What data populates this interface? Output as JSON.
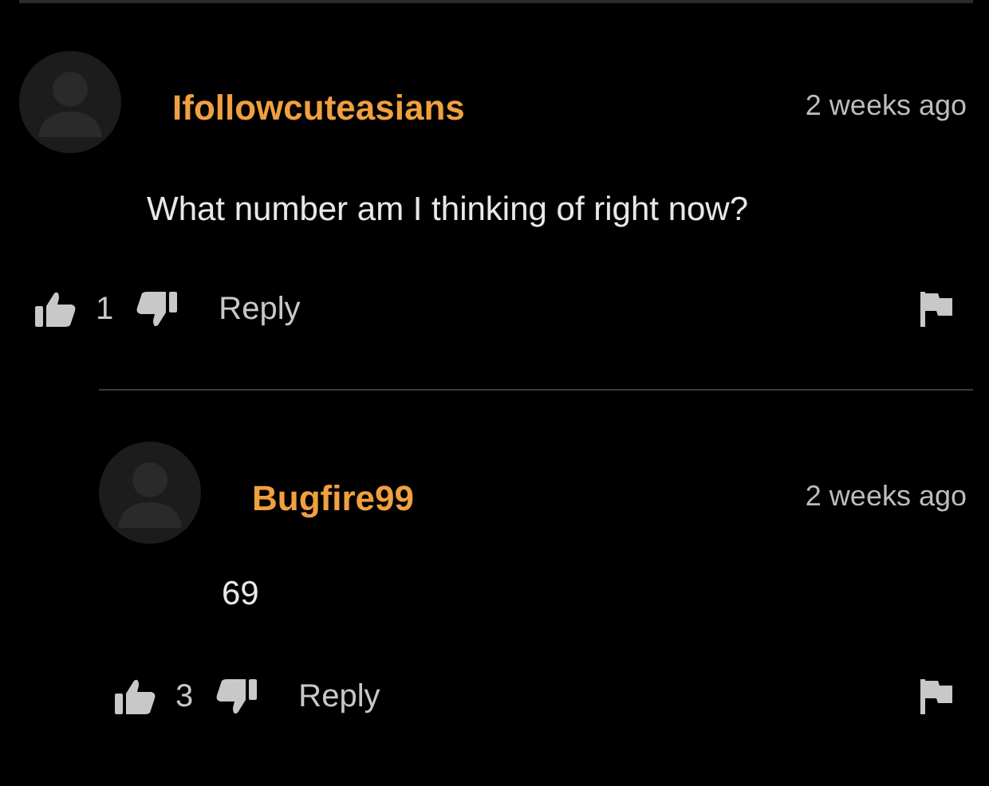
{
  "comments": [
    {
      "username": "Ifollowcuteasians",
      "time": "2 weeks ago",
      "text": "What number am I thinking of right now?",
      "likes": "1",
      "reply_label": "Reply",
      "children": [
        {
          "username": "Bugfire99",
          "time": "2 weeks ago",
          "text": "69",
          "likes": "3",
          "reply_label": "Reply"
        }
      ]
    }
  ]
}
